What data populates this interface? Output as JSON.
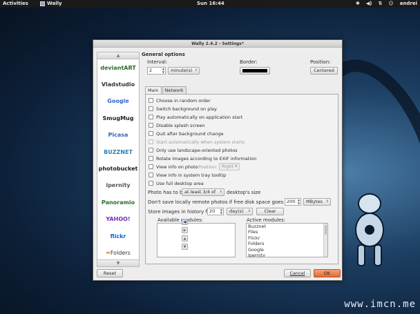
{
  "topbar": {
    "activities": "Activities",
    "app_name": "Wally",
    "clock": "Sun 16:44",
    "user": "andrei"
  },
  "watermark": "www.imcn.me",
  "window": {
    "title": "Wally 2.4.2 - Settings*"
  },
  "sidebar": {
    "sources": [
      {
        "label": "deviantART"
      },
      {
        "label": "Vladstudio"
      },
      {
        "label": "Google"
      },
      {
        "label": "SmugMug"
      },
      {
        "label": "Picasa"
      },
      {
        "label": "BUZZNET"
      },
      {
        "label": "photobucket"
      },
      {
        "label": "ipernity"
      },
      {
        "label": "Panoramio"
      },
      {
        "label": "YAHOO!"
      },
      {
        "label": "flickr"
      },
      {
        "label": "Folders"
      }
    ]
  },
  "general": {
    "section_title": "General options",
    "interval_label": "Interval:",
    "interval_value": "2",
    "interval_unit": "minute(s)",
    "border_label": "Border:",
    "border_color": "#000000",
    "position_label": "Position:",
    "position_value": "Centered"
  },
  "tabs": [
    {
      "label": "Main"
    },
    {
      "label": "Network"
    }
  ],
  "options": {
    "random_order": "Choose in random order",
    "switch_on_play": "Switch background on play",
    "play_on_start": "Play automatically on application start",
    "disable_splash": "Disable splash screen",
    "quit_after": "Quit after background change",
    "start_auto": "Start automatically when system starts",
    "landscape_only": "Only use landscape-oriented photos",
    "rotate_exif": "Rotate images according to EXIF information",
    "view_info": "View info on photo",
    "position_label": "Position:",
    "position_value": "Right",
    "view_tray": "View info in system tray tooltip",
    "full_desktop": "Use full desktop area"
  },
  "photo_size": {
    "prefix": "Photo has to be",
    "value": "at least 3/4 of",
    "suffix": "desktop's size"
  },
  "disk_space": {
    "label": "Don't save locally remote photos if free disk space goes below",
    "value": "200",
    "unit": "MBytes"
  },
  "history": {
    "label": "Store images in history for",
    "value": "20",
    "unit": "day(s)",
    "clear_label": "Clear"
  },
  "modules": {
    "available_label": "Available modules:",
    "active_label": "Active modules:",
    "active": [
      "Buzznet",
      "Files",
      "Flickr",
      "Folders",
      "Google",
      "Ipernity"
    ]
  },
  "footer": {
    "reset": "Reset",
    "cancel": "Cancel",
    "ok": "OK"
  }
}
